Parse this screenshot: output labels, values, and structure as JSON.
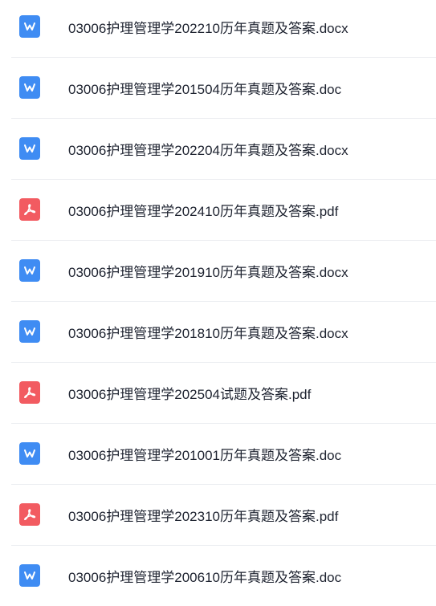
{
  "files": [
    {
      "name": "03006护理管理学202210历年真题及答案.docx",
      "type": "word",
      "icon": "word-icon"
    },
    {
      "name": "03006护理管理学201504历年真题及答案.doc",
      "type": "word",
      "icon": "word-icon"
    },
    {
      "name": "03006护理管理学202204历年真题及答案.docx",
      "type": "word",
      "icon": "word-icon"
    },
    {
      "name": "03006护理管理学202410历年真题及答案.pdf",
      "type": "pdf",
      "icon": "pdf-icon"
    },
    {
      "name": "03006护理管理学201910历年真题及答案.docx",
      "type": "word",
      "icon": "word-icon"
    },
    {
      "name": "03006护理管理学201810历年真题及答案.docx",
      "type": "word",
      "icon": "word-icon"
    },
    {
      "name": "03006护理管理学202504试题及答案.pdf",
      "type": "pdf",
      "icon": "pdf-icon"
    },
    {
      "name": "03006护理管理学201001历年真题及答案.doc",
      "type": "word",
      "icon": "word-icon"
    },
    {
      "name": "03006护理管理学202310历年真题及答案.pdf",
      "type": "pdf",
      "icon": "pdf-icon"
    },
    {
      "name": "03006护理管理学200610历年真题及答案.doc",
      "type": "word",
      "icon": "word-icon"
    }
  ],
  "colors": {
    "word": "#3f8cf3",
    "pdf": "#f25b61",
    "text": "#1e2330",
    "divider": "#eceef1"
  }
}
